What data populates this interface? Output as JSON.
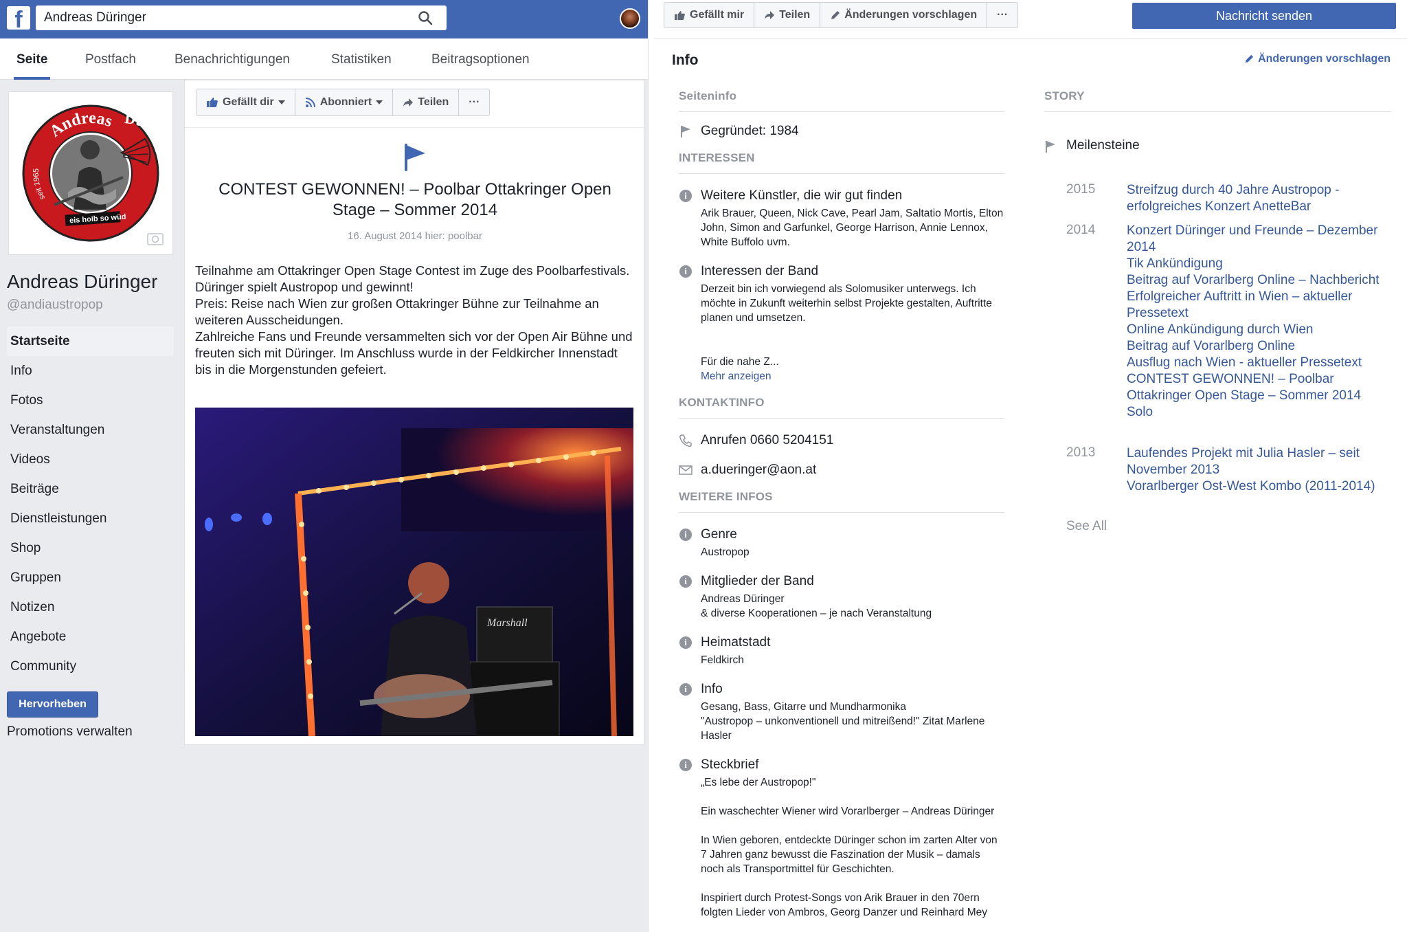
{
  "topbar": {
    "search_value": "Andreas Düringer"
  },
  "tabs": [
    "Seite",
    "Postfach",
    "Benachrichtigungen",
    "Statistiken",
    "Beitragsoptionen"
  ],
  "profile": {
    "name": "Andreas Düringer",
    "handle": "@andiaustropop",
    "logo_text_top": "Andreas",
    "logo_text_right": "Düringer",
    "logo_text_left": "seit 1965",
    "logo_text_bottom": "eis hoib so wüd"
  },
  "nav": [
    "Startseite",
    "Info",
    "Fotos",
    "Veranstaltungen",
    "Videos",
    "Beiträge",
    "Dienstleistungen",
    "Shop",
    "Gruppen",
    "Notizen",
    "Angebote",
    "Community"
  ],
  "promote_button": "Hervorheben",
  "promotions_manage": "Promotions verwalten",
  "post_actions": {
    "like": "Gefällt dir",
    "follow": "Abonniert",
    "share": "Teilen",
    "more": "···"
  },
  "post": {
    "title": "CONTEST GEWONNEN! – Poolbar Ottakringer Open Stage – Sommer 2014",
    "date": "16. August 2014 hier: poolbar",
    "paragraphs": [
      "Teilnahme am Ottakringer Open Stage Contest im Zuge des Poolbarfestivals.",
      "Düringer spielt Austropop und gewinnt!",
      "Preis: Reise nach Wien zur großen Ottakringer Bühne zur Teilnahme an weiteren Ausscheidungen.",
      "Zahlreiche Fans und Freunde versammelten sich vor der Open Air Bühne und freuten sich mit Düringer. Im Anschluss wurde in der Feldkircher Innenstadt bis in die Morgenstunden gefeiert."
    ],
    "photo_amp_text": "Marshall"
  },
  "right_actions": {
    "like": "Gefällt mir",
    "share": "Teilen",
    "suggest": "Änderungen vorschlagen",
    "more": "···"
  },
  "message_button": "Nachricht senden",
  "info_title": "Info",
  "suggest_link": "Änderungen vorschlagen",
  "info": {
    "seiteninfo_head": "Seiteninfo",
    "founded": "Gegründet: 1984",
    "interests_head": "INTERESSEN",
    "artists_title": "Weitere Künstler, die wir gut finden",
    "artists_text": "Arik Brauer, Queen, Nick Cave, Pearl Jam, Saltatio Mortis, Elton John, Simon and Garfunkel, George Harrison, Annie Lennox, White Buffolo uvm.",
    "band_interests_title": "Interessen der Band",
    "band_interests_text": "Derzeit bin ich vorwiegend als Solomusiker unterwegs. Ich möchte in Zukunft weiterhin selbst Projekte gestalten, Auftritte planen und umsetzen.",
    "band_interests_more_prefix": "Für die nahe Z...",
    "band_interests_more_link": "Mehr anzeigen",
    "contact_head": "KONTAKTINFO",
    "phone": "Anrufen 0660 5204151",
    "email": "a.dueringer@aon.at",
    "more_head": "WEITERE INFOS",
    "genre_title": "Genre",
    "genre_text": "Austropop",
    "members_title": "Mitglieder der Band",
    "members_text": "Andreas Düringer\n& diverse Kooperationen – je nach Veranstaltung",
    "hometown_title": "Heimatstadt",
    "hometown_text": "Feldkirch",
    "info2_title": "Info",
    "info2_text": "Gesang, Bass, Gitarre und Mundharmonika\n\"Austropop – unkonventionell und mitreißend!\" Zitat Marlene Hasler",
    "profile_title": "Steckbrief",
    "profile_text": "„Es lebe der Austropop!\"\n\nEin waschechter Wiener wird Vorarlberger – Andreas Düringer\n\nIn Wien geboren, entdeckte Düringer schon im zarten Alter von 7 Jahren ganz bewusst die Faszination der Musik – damals noch als Transportmittel für Geschichten.\n\nInspiriert durch Protest-Songs von Arik Brauer in den 70ern folgten Lieder von Ambros, Georg Danzer und Reinhard Mey"
  },
  "story": {
    "head": "STORY",
    "milestones_label": "Meilensteine",
    "years": [
      {
        "year": "2015",
        "items": [
          "Streifzug durch 40 Jahre Austropop - erfolgreiches Konzert AnetteBar"
        ]
      },
      {
        "year": "2014",
        "items": [
          "Konzert Düringer und Freunde – Dezember 2014",
          "Tik Ankündigung",
          "Beitrag auf Vorarlberg Online – Nachbericht",
          "Erfolgreicher Auftritt in Wien – aktueller Pressetext",
          "Online Ankündigung durch Wien",
          "Beitrag auf Vorarlberg Online",
          "Ausflug nach Wien - aktueller Pressetext",
          "CONTEST GEWONNEN! – Poolbar Ottakringer Open Stage – Sommer 2014",
          "Solo"
        ]
      },
      {
        "year": "2013",
        "items": [
          "Laufendes Projekt mit Julia Hasler – seit November 2013",
          "Vorarlberger Ost-West Kombo (2011-2014)"
        ]
      }
    ],
    "see_all": "See All"
  },
  "colors": {
    "brand": "#4267b2",
    "link": "#365899",
    "muted": "#90949c",
    "bg": "#e9ebee"
  }
}
